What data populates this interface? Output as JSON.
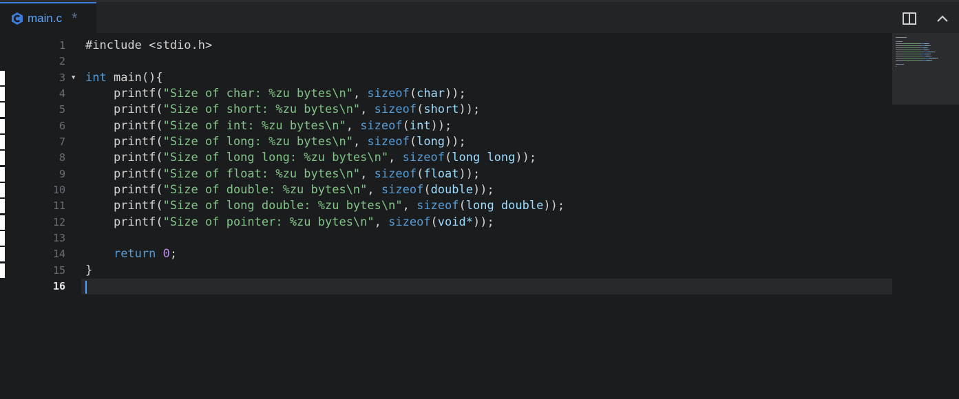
{
  "tab": {
    "title": "main.c",
    "dirty_mark": "*",
    "icon": "c-language-icon"
  },
  "toolbar": {
    "split_icon": "split-editor-icon",
    "collapse_icon": "chevron-up-icon"
  },
  "editor": {
    "active_line": 16,
    "lines": [
      {
        "n": "1",
        "tokens": [
          {
            "t": "#include <stdio.h>",
            "c": "fn"
          }
        ]
      },
      {
        "n": "2",
        "tokens": []
      },
      {
        "n": "3",
        "fold": "▼",
        "tokens": [
          {
            "t": "int",
            "c": "kw"
          },
          {
            "t": " main(){",
            "c": "fn"
          }
        ]
      },
      {
        "n": "4",
        "tokens": [
          {
            "t": "    printf(",
            "c": "fn"
          },
          {
            "t": "\"Size of char: %zu bytes\\n\"",
            "c": "str"
          },
          {
            "t": ", ",
            "c": "fn"
          },
          {
            "t": "sizeof",
            "c": "kw"
          },
          {
            "t": "(",
            "c": "fn"
          },
          {
            "t": "char",
            "c": "ty"
          },
          {
            "t": "));",
            "c": "fn"
          }
        ]
      },
      {
        "n": "5",
        "tokens": [
          {
            "t": "    printf(",
            "c": "fn"
          },
          {
            "t": "\"Size of short: %zu bytes\\n\"",
            "c": "str"
          },
          {
            "t": ", ",
            "c": "fn"
          },
          {
            "t": "sizeof",
            "c": "kw"
          },
          {
            "t": "(",
            "c": "fn"
          },
          {
            "t": "short",
            "c": "ty"
          },
          {
            "t": "));",
            "c": "fn"
          }
        ]
      },
      {
        "n": "6",
        "tokens": [
          {
            "t": "    printf(",
            "c": "fn"
          },
          {
            "t": "\"Size of int: %zu bytes\\n\"",
            "c": "str"
          },
          {
            "t": ", ",
            "c": "fn"
          },
          {
            "t": "sizeof",
            "c": "kw"
          },
          {
            "t": "(",
            "c": "fn"
          },
          {
            "t": "int",
            "c": "ty"
          },
          {
            "t": "));",
            "c": "fn"
          }
        ]
      },
      {
        "n": "7",
        "tokens": [
          {
            "t": "    printf(",
            "c": "fn"
          },
          {
            "t": "\"Size of long: %zu bytes\\n\"",
            "c": "str"
          },
          {
            "t": ", ",
            "c": "fn"
          },
          {
            "t": "sizeof",
            "c": "kw"
          },
          {
            "t": "(",
            "c": "fn"
          },
          {
            "t": "long",
            "c": "ty"
          },
          {
            "t": "));",
            "c": "fn"
          }
        ]
      },
      {
        "n": "8",
        "tokens": [
          {
            "t": "    printf(",
            "c": "fn"
          },
          {
            "t": "\"Size of long long: %zu bytes\\n\"",
            "c": "str"
          },
          {
            "t": ", ",
            "c": "fn"
          },
          {
            "t": "sizeof",
            "c": "kw"
          },
          {
            "t": "(",
            "c": "fn"
          },
          {
            "t": "long long",
            "c": "ty"
          },
          {
            "t": "));",
            "c": "fn"
          }
        ]
      },
      {
        "n": "9",
        "tokens": [
          {
            "t": "    printf(",
            "c": "fn"
          },
          {
            "t": "\"Size of float: %zu bytes\\n\"",
            "c": "str"
          },
          {
            "t": ", ",
            "c": "fn"
          },
          {
            "t": "sizeof",
            "c": "kw"
          },
          {
            "t": "(",
            "c": "fn"
          },
          {
            "t": "float",
            "c": "ty"
          },
          {
            "t": "));",
            "c": "fn"
          }
        ]
      },
      {
        "n": "10",
        "tokens": [
          {
            "t": "    printf(",
            "c": "fn"
          },
          {
            "t": "\"Size of double: %zu bytes\\n\"",
            "c": "str"
          },
          {
            "t": ", ",
            "c": "fn"
          },
          {
            "t": "sizeof",
            "c": "kw"
          },
          {
            "t": "(",
            "c": "fn"
          },
          {
            "t": "double",
            "c": "ty"
          },
          {
            "t": "));",
            "c": "fn"
          }
        ]
      },
      {
        "n": "11",
        "tokens": [
          {
            "t": "    printf(",
            "c": "fn"
          },
          {
            "t": "\"Size of long double: %zu bytes\\n\"",
            "c": "str"
          },
          {
            "t": ", ",
            "c": "fn"
          },
          {
            "t": "sizeof",
            "c": "kw"
          },
          {
            "t": "(",
            "c": "fn"
          },
          {
            "t": "long double",
            "c": "ty"
          },
          {
            "t": "));",
            "c": "fn"
          }
        ]
      },
      {
        "n": "12",
        "tokens": [
          {
            "t": "    printf(",
            "c": "fn"
          },
          {
            "t": "\"Size of pointer: %zu bytes\\n\"",
            "c": "str"
          },
          {
            "t": ", ",
            "c": "fn"
          },
          {
            "t": "sizeof",
            "c": "kw"
          },
          {
            "t": "(",
            "c": "fn"
          },
          {
            "t": "void*",
            "c": "ty"
          },
          {
            "t": "));",
            "c": "fn"
          }
        ]
      },
      {
        "n": "13",
        "tokens": []
      },
      {
        "n": "14",
        "tokens": [
          {
            "t": "    ",
            "c": "fn"
          },
          {
            "t": "return",
            "c": "kw"
          },
          {
            "t": " ",
            "c": "fn"
          },
          {
            "t": "0",
            "c": "num"
          },
          {
            "t": ";",
            "c": "fn"
          }
        ]
      },
      {
        "n": "15",
        "tokens": [
          {
            "t": "}",
            "c": "fn"
          }
        ]
      },
      {
        "n": "16",
        "tokens": []
      }
    ]
  },
  "colors": {
    "background": "#1b1c1e",
    "accent": "#3b7dd8",
    "keyword": "#569cd6",
    "type": "#9cdcfe",
    "string": "#82c488",
    "number": "#b78be6"
  }
}
